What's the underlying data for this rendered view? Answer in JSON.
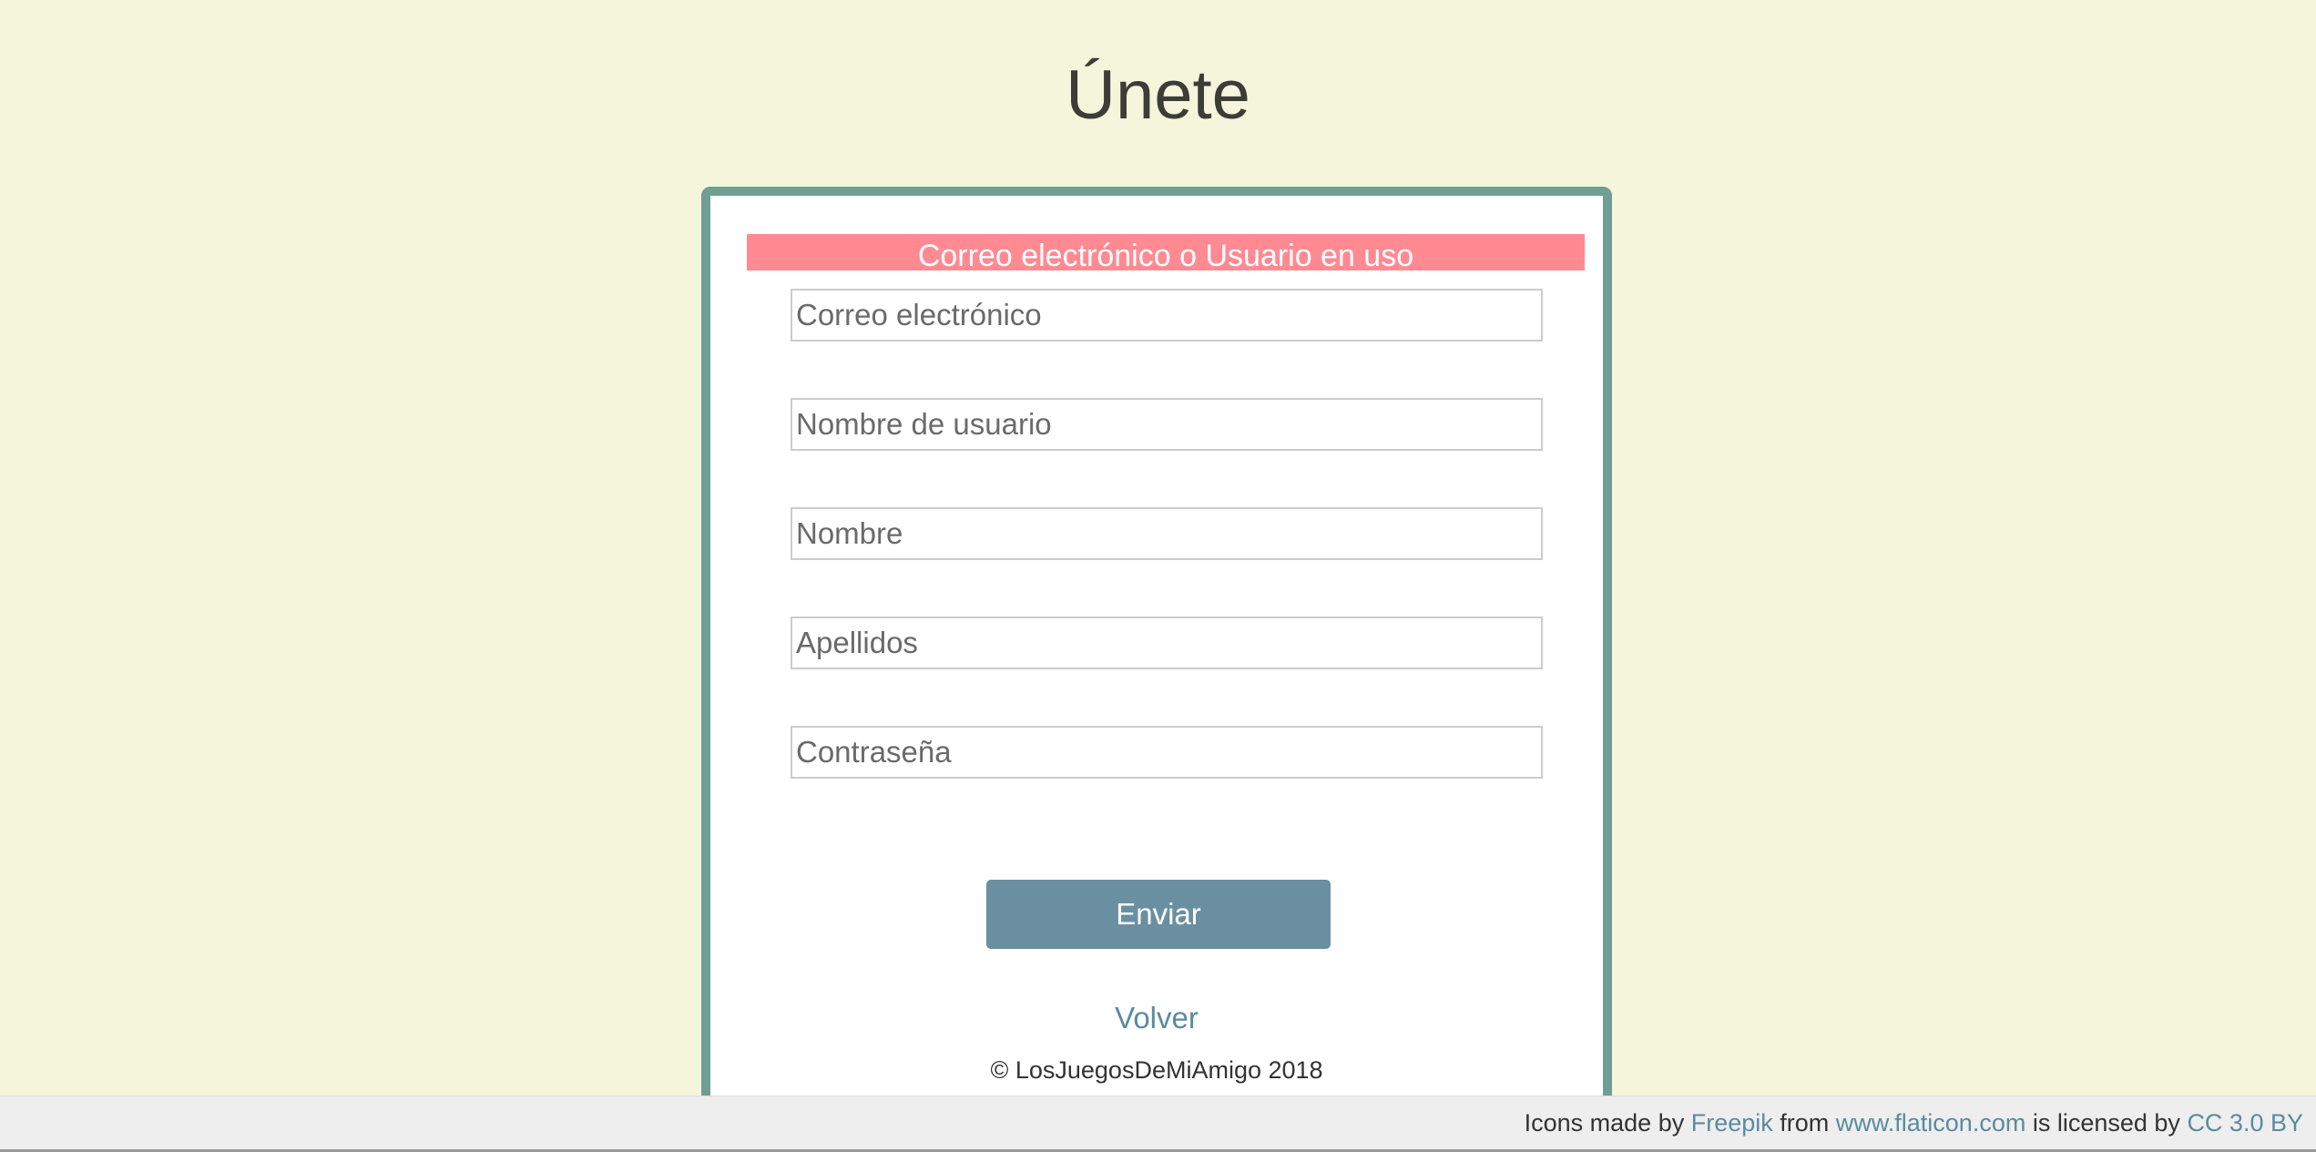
{
  "page": {
    "title": "Únete"
  },
  "form": {
    "error_message": "Correo electrónico o Usuario en uso",
    "fields": {
      "email_placeholder": "Correo electrónico",
      "username_placeholder": "Nombre de usuario",
      "name_placeholder": "Nombre",
      "surname_placeholder": "Apellidos",
      "password_placeholder": "Contraseña"
    },
    "submit_label": "Enviar",
    "back_label": "Volver",
    "copyright": "© LosJuegosDeMiAmigo 2018"
  },
  "footer": {
    "prefix": "Icons made by ",
    "author": "Freepik",
    "middle": " from ",
    "site": "www.flaticon.com",
    "license_text": " is licensed by ",
    "license": "CC 3.0 BY"
  },
  "colors": {
    "background": "#f5f5dc",
    "card_border": "#6f9e94",
    "error": "#ff8a92",
    "button": "#6a8fa0",
    "link": "#5a8ba0"
  }
}
